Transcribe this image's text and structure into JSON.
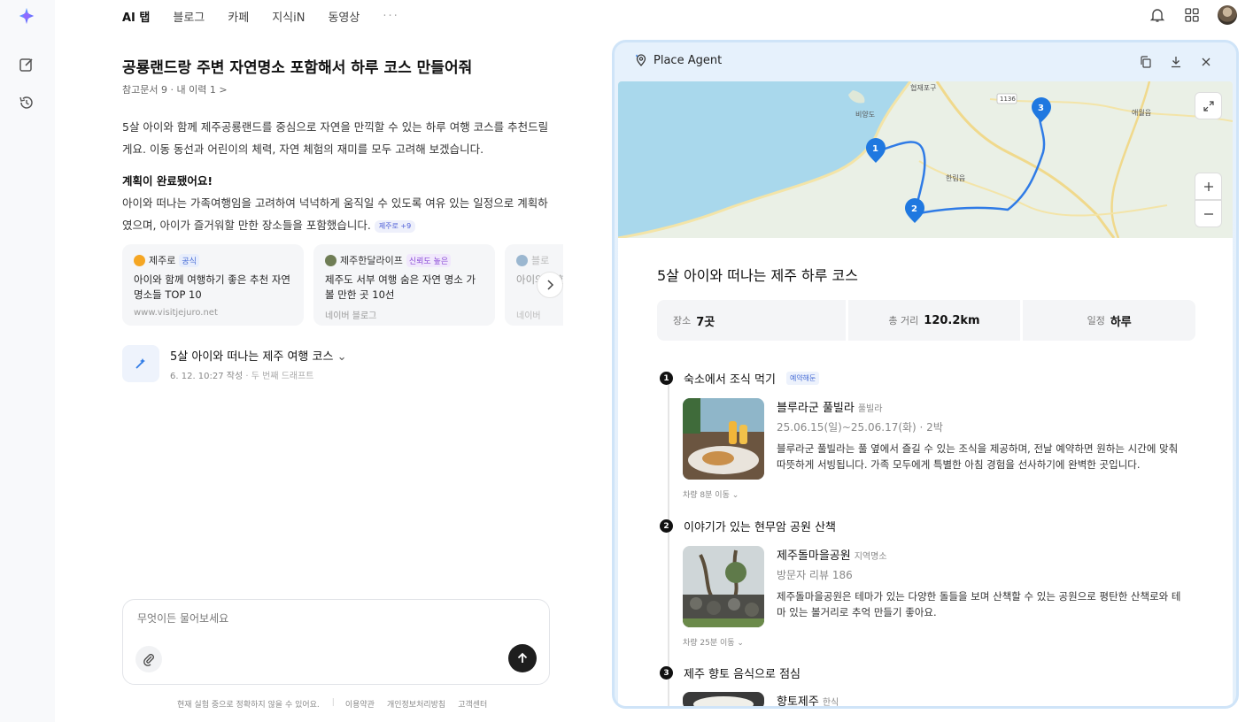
{
  "top_nav": {
    "tabs": [
      "AI 탭",
      "블로그",
      "카페",
      "지식iN",
      "동영상"
    ],
    "more": "···"
  },
  "left": {
    "question": "공룡랜드랑 주변 자연명소 포함해서 하루 코스 만들어줘",
    "refs": "참고문서 9 · 내 이력 1 >",
    "intro": "5살 아이와 함께 제주공룡랜드를 중심으로 자연을 만끽할 수 있는 하루 여행 코스를 추천드릴게요. 이동 동선과 어린이의 체력, 자연 체험의 재미를 모두 고려해 보겠습니다.",
    "plan_done": "계획이 완료됐어요!",
    "plan_desc": "아이와 떠나는 가족여행임을 고려하여 넉넉하게 움직일 수 있도록 여유 있는 일정으로 계획하였으며, 아이가 즐거워할 만한 장소들을 포함했습니다.",
    "source_chip": "제주로 +9",
    "cards": [
      {
        "source": "제주로",
        "tag": "공식",
        "title": "아이와 함께 여행하기 좋은 추천 자연명소들 TOP 10",
        "site": "www.visitjejuro.net"
      },
      {
        "source": "제주한달라이프",
        "tag": "신뢰도 높은",
        "title": "제주도 서부 여행 숨은 자연 명소 가볼 만한 곳 10선",
        "site": "네이버 블로그"
      },
      {
        "source": "블로",
        "tag": "",
        "title": "아이와 만한",
        "site": "네이버"
      }
    ],
    "draft": {
      "title": "5살 아이와 떠나는 제주 여행 코스",
      "meta": "6. 12. 10:27 작성",
      "meta2": "· 두 번째 드래프트"
    },
    "composer_placeholder": "무엇이든 물어보세요",
    "footer": {
      "notice": "현재 실험 중으로 정확하지 않을 수 있어요.",
      "terms": "이용약관",
      "privacy": "개인정보처리방침",
      "support": "고객센터"
    }
  },
  "panel": {
    "title": "Place Agent",
    "map_labels": {
      "port": "협재포구",
      "island": "비양도",
      "town": "한림읍",
      "village": "애월읍",
      "road": "1136"
    },
    "course_title": "5살 아이와 떠나는 제주 하루 코스",
    "stats": [
      {
        "label": "장소",
        "value": "7곳"
      },
      {
        "label": "총 거리",
        "value": "120.2km"
      },
      {
        "label": "일정",
        "value": "하루"
      }
    ],
    "steps": [
      {
        "num": "1",
        "title": "숙소에서 조식 먹기",
        "badge": "예약해둔",
        "place": "블루라군 풀빌라",
        "category": "풀빌라",
        "meta": "25.06.15(일)~25.06.17(화) · 2박",
        "desc": "블루라군 풀빌라는 풀 옆에서 즐길 수 있는 조식을 제공하며, 전날 예약하면 원하는 시간에 맞춰 따뜻하게 서빙됩니다. 가족 모두에게 특별한 아침 경험을 선사하기에 완벽한 곳입니다.",
        "move": "차량 8분 이동 ⌄"
      },
      {
        "num": "2",
        "title": "이야기가 있는 현무암 공원 산책",
        "badge": "",
        "place": "제주돌마을공원",
        "category": "지역명소",
        "meta": "방문자 리뷰 186",
        "desc": "제주돌마을공원은 테마가 있는 다양한 돌들을 보며 산책할 수 있는 공원으로 평탄한 산책로와 테마 있는 볼거리로 추억 만들기 좋아요.",
        "move": "차량 25분 이동 ⌄"
      },
      {
        "num": "3",
        "title": "제주 향토 음식으로 점심",
        "badge": "",
        "place": "향토제주",
        "category": "한식",
        "meta": "",
        "desc": "",
        "move": ""
      }
    ]
  },
  "colors": {
    "accent": "#2f7be6",
    "panel_bg": "#e6f1fc",
    "pin": "#1f78e0"
  }
}
